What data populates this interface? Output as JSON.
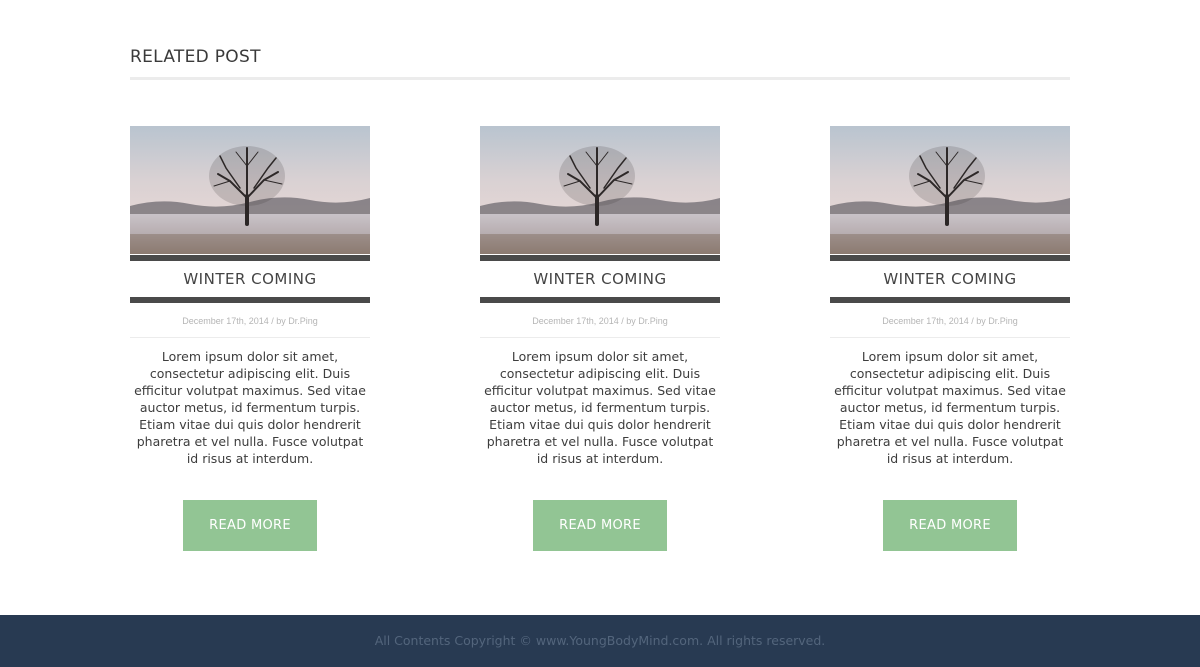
{
  "section": {
    "title": "RELATED POST"
  },
  "posts": [
    {
      "title": "WINTER COMING",
      "meta": "December 17th, 2014 / by Dr.Ping",
      "excerpt": "Lorem ipsum dolor sit amet, consectetur adipiscing elit. Duis efficitur volutpat maximus. Sed vitae auctor metus, id fermentum turpis. Etiam vitae dui quis dolor hendrerit pharetra et vel nulla. Fusce volutpat id risus at interdum.",
      "button": "READ MORE",
      "image": "winter-tree-photo"
    },
    {
      "title": "WINTER COMING",
      "meta": "December 17th, 2014 / by Dr.Ping",
      "excerpt": "Lorem ipsum dolor sit amet, consectetur adipiscing elit. Duis efficitur volutpat maximus. Sed vitae auctor metus, id fermentum turpis. Etiam vitae dui quis dolor hendrerit pharetra et vel nulla. Fusce volutpat id risus at interdum.",
      "button": "READ MORE",
      "image": "winter-tree-photo"
    },
    {
      "title": "WINTER COMING",
      "meta": "December 17th, 2014 / by Dr.Ping",
      "excerpt": "Lorem ipsum dolor sit amet, consectetur adipiscing elit. Duis efficitur volutpat maximus. Sed vitae auctor metus, id fermentum turpis. Etiam vitae dui quis dolor hendrerit pharetra et vel nulla. Fusce volutpat id risus at interdum.",
      "button": "READ MORE",
      "image": "winter-tree-photo"
    }
  ],
  "footer": {
    "copyright": "All Contents Copyright © www.YoungBodyMind.com. All rights reserved."
  },
  "colors": {
    "button": "#92c594",
    "footer": "#283a52",
    "bar": "#4a4a4a"
  }
}
